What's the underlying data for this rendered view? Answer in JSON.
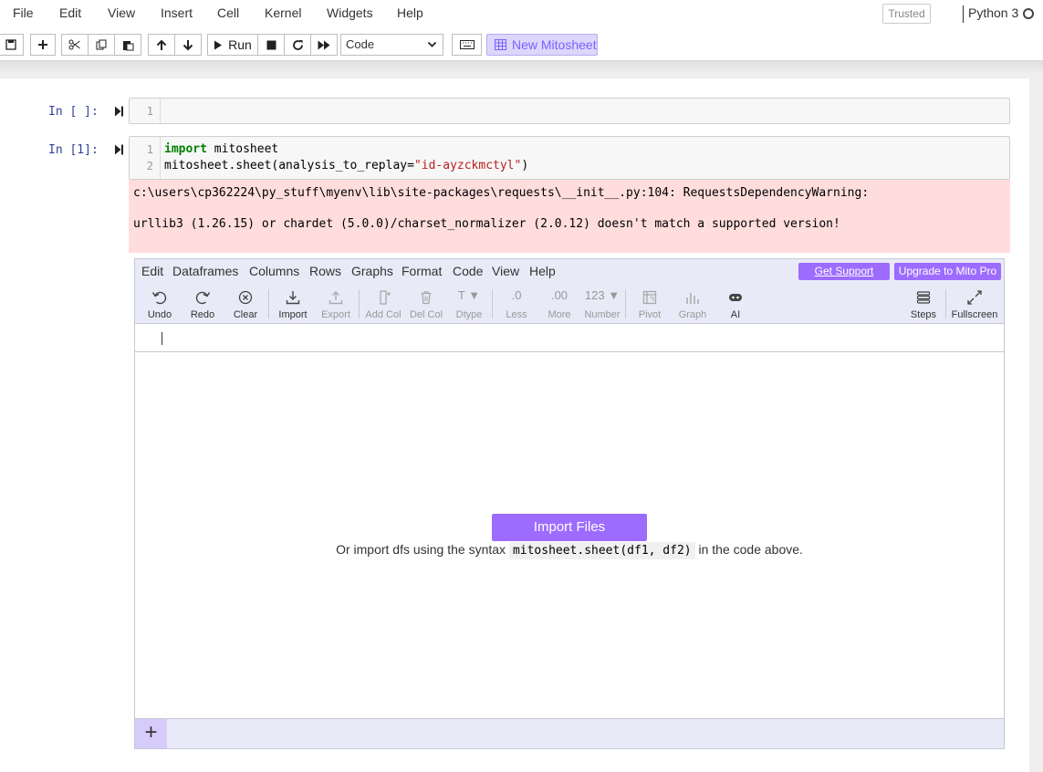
{
  "menubar": {
    "items": [
      "File",
      "Edit",
      "View",
      "Insert",
      "Cell",
      "Kernel",
      "Widgets",
      "Help"
    ],
    "trusted": "Trusted",
    "kernel_name": "Python 3"
  },
  "toolbar": {
    "run_label": "Run",
    "cell_type": "Code",
    "new_mitosheet_label": "New Mitosheet"
  },
  "cells": [
    {
      "prompt": "In [ ]:",
      "line_numbers": [
        "1"
      ],
      "code": [
        ""
      ]
    },
    {
      "prompt": "In [1]:",
      "line_numbers": [
        "1",
        "2"
      ],
      "code": [
        "import mitosheet",
        "mitosheet.sheet(analysis_to_replay=\"id-ayzckmctyl\")"
      ]
    }
  ],
  "stderr": {
    "line1": "c:\\users\\cp362224\\py_stuff\\myenv\\lib\\site-packages\\requests\\__init__.py:104: RequestsDependencyWarning:",
    "line2": "urllib3 (1.26.15) or chardet (5.0.0)/charset_normalizer (2.0.12) doesn't match a supported version!"
  },
  "mito": {
    "menu": [
      "Edit",
      "Dataframes",
      "Columns",
      "Rows",
      "Graphs",
      "Format",
      "Code",
      "View",
      "Help"
    ],
    "get_support": "Get Support",
    "upgrade": "Upgrade to Mito Pro",
    "tools": {
      "undo": "Undo",
      "redo": "Redo",
      "clear": "Clear",
      "import": "Import",
      "export": "Export",
      "add_col": "Add Col",
      "del_col": "Del Col",
      "dtype": "Dtype",
      "less": "Less",
      "more": "More",
      "number": "Number",
      "pivot": "Pivot",
      "graph": "Graph",
      "ai": "AI",
      "steps": "Steps",
      "fullscreen": "Fullscreen"
    },
    "tool_glyphs": {
      "dtype": "T ▼",
      "less": ".0",
      "more": ".00",
      "number": "123 ▼"
    },
    "import_button": "Import Files",
    "hint_before": "Or import dfs using the syntax",
    "hint_code": "mitosheet.sheet(df1, df2)",
    "hint_after": "in the code above.",
    "add_sheet": "+"
  }
}
